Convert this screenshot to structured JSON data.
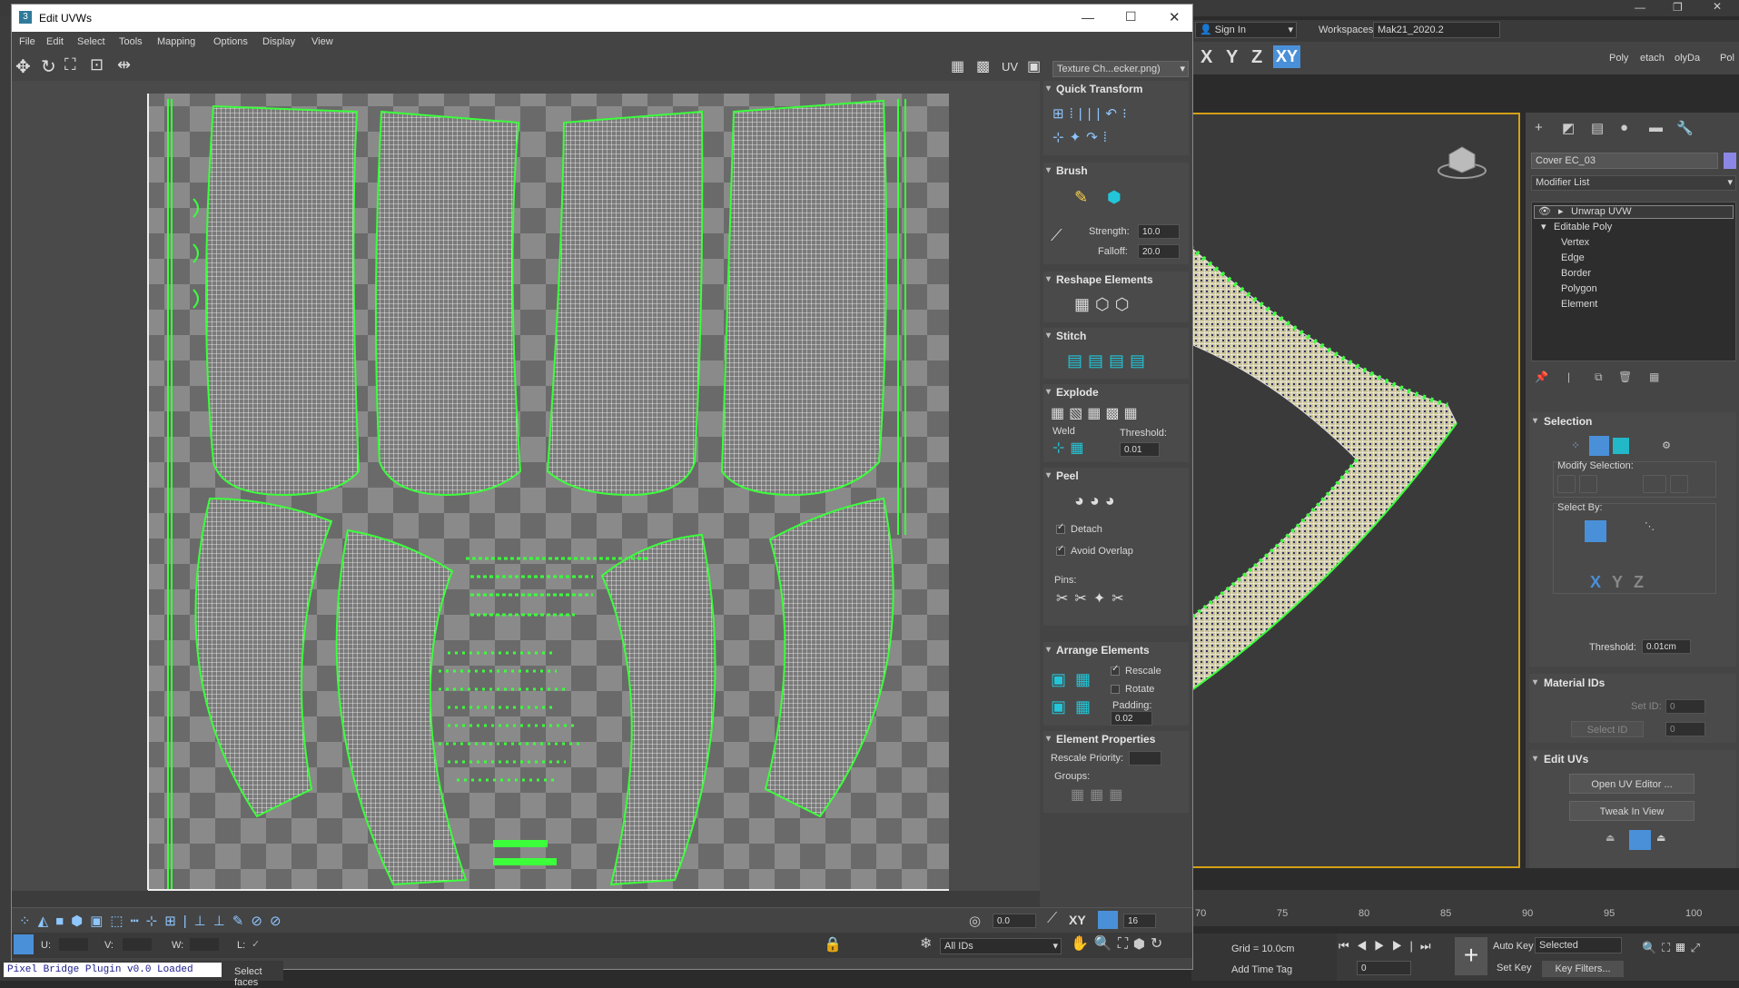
{
  "max_topbar": {
    "sign_in": "Sign In",
    "workspaces_label": "Workspaces:",
    "workspace_value": "Mak21_2020.2",
    "axes": [
      "X",
      "Y",
      "Z",
      "XY"
    ],
    "right_labels": [
      "Poly",
      "etach",
      "olyDa",
      "Pol"
    ]
  },
  "uvw_window": {
    "title": "Edit UVWs",
    "menu": [
      "File",
      "Edit",
      "Select",
      "Tools",
      "Mapping",
      "Options",
      "Display",
      "View"
    ],
    "uv_label": "UV",
    "texture_dropdown": "Texture Ch...ecker.png)"
  },
  "panels": {
    "quick_transform": "Quick Transform",
    "brush": "Brush",
    "strength_label": "Strength:",
    "strength_value": "10.0",
    "falloff_label": "Falloff:",
    "falloff_value": "20.0",
    "reshape": "Reshape Elements",
    "stitch": "Stitch",
    "explode": "Explode",
    "weld": "Weld",
    "threshold_label": "Threshold:",
    "threshold_value": "0.01",
    "peel": "Peel",
    "detach": "Detach",
    "avoid_overlap": "Avoid Overlap",
    "pins": "Pins:",
    "arrange": "Arrange Elements",
    "rescale": "Rescale",
    "rotate": "Rotate",
    "padding_label": "Padding:",
    "padding_value": "0.02",
    "element_props": "Element Properties",
    "rescale_priority": "Rescale Priority:",
    "groups": "Groups:"
  },
  "uv_bottom": {
    "value_a": "0.0",
    "xy": "XY",
    "value_b": "16",
    "u_label": "U:",
    "v_label": "V:",
    "w_label": "W:",
    "l_label": "L:",
    "all_ids": "All IDs"
  },
  "status": {
    "left_text": "Pixel Bridge Plugin v0.0 Loaded",
    "prompt": "Select faces"
  },
  "command_panel": {
    "object_name": "Cover EC_03",
    "modifier_list": "Modifier List",
    "stack": [
      "Unwrap UVW",
      "Editable Poly",
      "Vertex",
      "Edge",
      "Border",
      "Polygon",
      "Element"
    ],
    "selection": "Selection",
    "modify_selection": "Modify Selection:",
    "select_by": "Select By:",
    "threshold_label": "Threshold:",
    "threshold_value": "0.01cm",
    "material_ids": "Material IDs",
    "set_id": "Set ID:",
    "select_id": "Select ID",
    "id_value": "0",
    "edit_uvs": "Edit UVs",
    "open_uv_editor": "Open UV Editor ...",
    "tweak_in_view": "Tweak In View"
  },
  "timeline": {
    "ticks": [
      "70",
      "75",
      "80",
      "85",
      "90",
      "95",
      "100"
    ],
    "grid": "Grid = 10.0cm",
    "add_time_tag": "Add Time Tag",
    "auto_key": "Auto Key",
    "set_key": "Set Key",
    "selected": "Selected",
    "key_filters": "Key Filters...",
    "frame": "0"
  },
  "colors": {
    "uv_green": "#3cff3c",
    "accent_blue": "#4a90d9",
    "viewport_border": "#d4a017"
  }
}
